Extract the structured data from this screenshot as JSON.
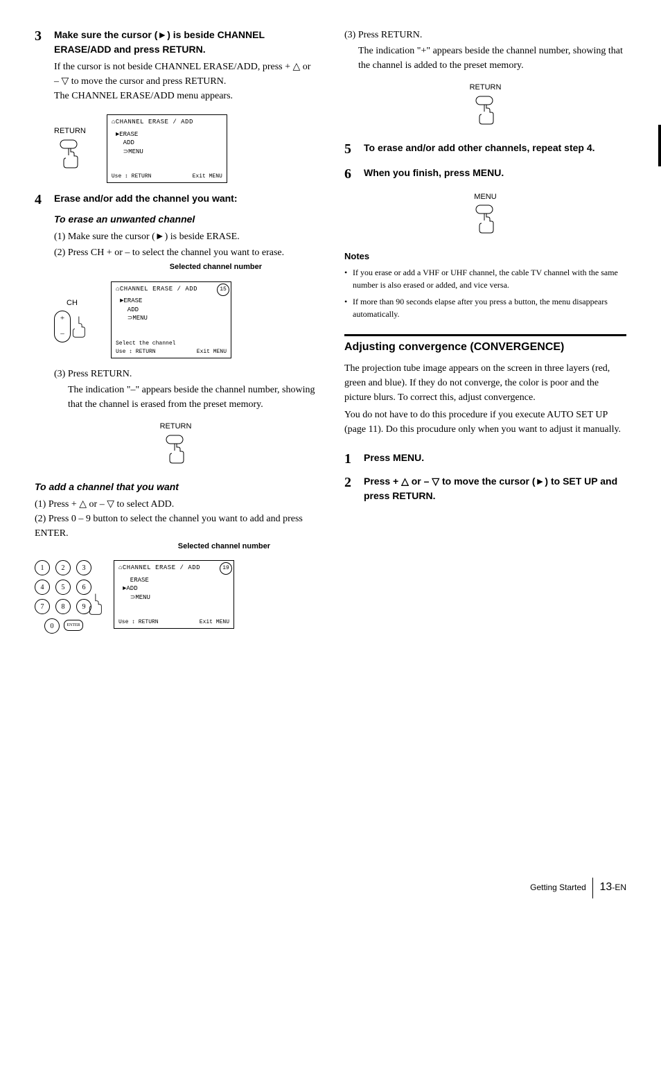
{
  "left": {
    "step3": {
      "num": "3",
      "title": "Make sure the cursor (►) is beside CHANNEL ERASE/ADD and press RETURN.",
      "body1": "If the cursor is not beside CHANNEL ERASE/ADD, press + △ or – ▽ to move the cursor and press RETURN.",
      "body2": "The CHANNEL ERASE/ADD menu appears.",
      "return_label": "RETURN",
      "menu": {
        "title": "⌂CHANNEL  ERASE / ADD",
        "items": "►ERASE\n  ADD\n  ⊃MENU",
        "use": "Use ↕ RETURN",
        "exit": "Exit MENU"
      }
    },
    "step4": {
      "num": "4",
      "title": "Erase and/or add the channel you want:",
      "erase_head": "To erase an unwanted channel",
      "s1": "(1) Make sure the cursor (►) is beside ERASE.",
      "s2": "(2) Press CH + or – to select the channel you want to erase.",
      "caption": "Selected channel number",
      "ch_label": "CH",
      "menu": {
        "title": "⌂CHANNEL  ERASE / ADD",
        "badge": "15",
        "items": "►ERASE\n  ADD\n  ⊃MENU",
        "select": "Select the channel",
        "use": "Use ↕ RETURN",
        "exit": "Exit MENU"
      },
      "s3": "(3) Press RETURN.",
      "s3_body": "The indication \"–\" appears beside the channel number, showing that the channel is erased from the preset memory.",
      "return_label": "RETURN",
      "add_head": "To add a channel that you want",
      "a1": "(1) Press + △ or – ▽ to select ADD.",
      "a2": "(2) Press 0 – 9 button to select the channel you want to add and press ENTER.",
      "caption2": "Selected channel number",
      "keypad": [
        "1",
        "2",
        "3",
        "4",
        "5",
        "6",
        "7",
        "8",
        "9",
        "0"
      ],
      "enter": "ENTER",
      "menu2": {
        "title": "⌂CHANNEL  ERASE / ADD",
        "badge": "19",
        "items": "  ERASE\n►ADD\n  ⊃MENU",
        "use": "Use ↕ RETURN",
        "exit": "Exit MENU"
      }
    }
  },
  "right": {
    "cont": {
      "s3": "(3) Press RETURN.",
      "s3_body": "The indication \"+\" appears beside the channel number, showing that the channel is added to the preset memory.",
      "return_label": "RETURN"
    },
    "step5": {
      "num": "5",
      "title": "To erase and/or add other channels, repeat step 4."
    },
    "step6": {
      "num": "6",
      "title": "When you finish, press MENU.",
      "menu_label": "MENU"
    },
    "notes_head": "Notes",
    "note1": "If you erase or add a VHF or UHF channel, the cable TV channel with the same number is also erased or added, and vice versa.",
    "note2": "If more than 90 seconds elapse after you press a button, the menu disappears automatically.",
    "conv_title": "Adjusting convergence (CONVERGENCE)",
    "conv_p1": "The projection tube image appears on the screen in three layers (red, green and blue). If they do not converge, the color is poor and the picture blurs. To correct this, adjust convergence.",
    "conv_p2": "You do not have to do this procedure if you execute AUTO SET UP (page 11). Do this procudure only when you want to adjust it manually.",
    "cstep1": {
      "num": "1",
      "title": "Press MENU."
    },
    "cstep2": {
      "num": "2",
      "title": "Press + △ or – ▽ to move the cursor (►) to SET UP and press RETURN."
    }
  },
  "footer": {
    "section": "Getting Started",
    "page": "13",
    "suffix": "-EN"
  }
}
